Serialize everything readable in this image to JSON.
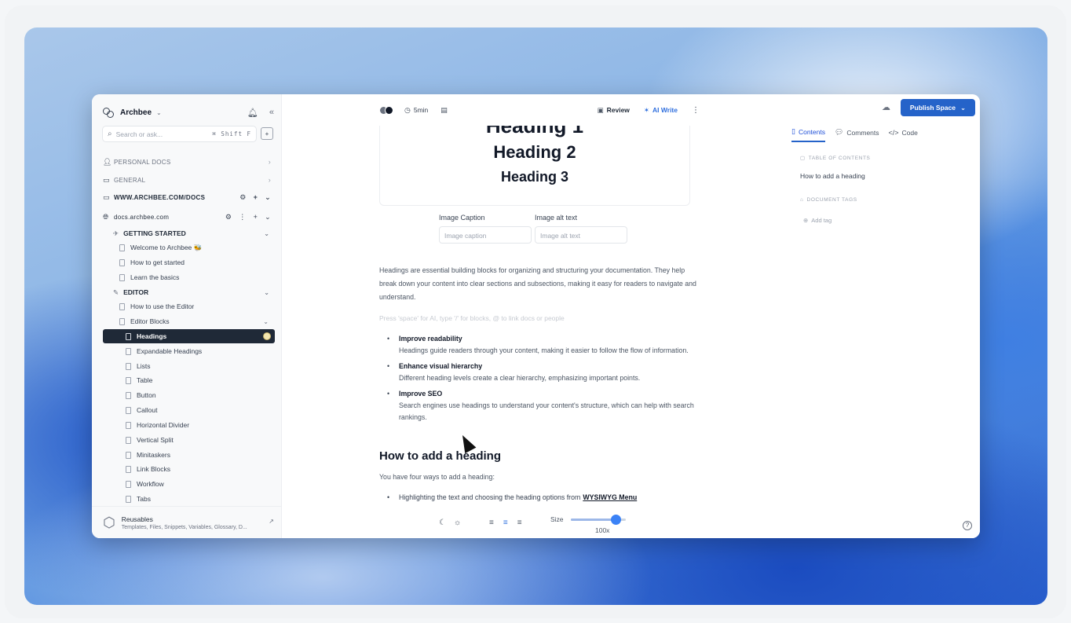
{
  "sidebar": {
    "brand": "Archbee",
    "search_placeholder": "Search or ask...",
    "search_shortcut": "⌘ Shift F",
    "sections": [
      {
        "label": "PERSONAL DOCS"
      },
      {
        "label": "GENERAL"
      },
      {
        "label": "WWW.ARCHBEE.COM/DOCS"
      },
      {
        "label": "docs.archbee.com"
      }
    ],
    "tree": [
      {
        "label": "GETTING STARTED",
        "type": "group"
      },
      {
        "label": "Welcome to Archbee 🐝",
        "type": "doc"
      },
      {
        "label": "How to get started",
        "type": "doc"
      },
      {
        "label": "Learn the basics",
        "type": "doc"
      },
      {
        "label": "EDITOR",
        "type": "group"
      },
      {
        "label": "How to use the Editor",
        "type": "doc"
      },
      {
        "label": "Editor Blocks",
        "type": "doc"
      },
      {
        "label": "Headings",
        "type": "doc",
        "active": true
      },
      {
        "label": "Expandable Headings",
        "type": "doc"
      },
      {
        "label": "Lists",
        "type": "doc"
      },
      {
        "label": "Table",
        "type": "doc"
      },
      {
        "label": "Button",
        "type": "doc"
      },
      {
        "label": "Callout",
        "type": "doc"
      },
      {
        "label": "Horizontal Divider",
        "type": "doc"
      },
      {
        "label": "Vertical Split",
        "type": "doc"
      },
      {
        "label": "Minitaskers",
        "type": "doc"
      },
      {
        "label": "Link Blocks",
        "type": "doc"
      },
      {
        "label": "Workflow",
        "type": "doc"
      },
      {
        "label": "Tabs",
        "type": "doc"
      }
    ],
    "reusables": {
      "title": "Reusables",
      "subtitle": "Templates, Files, Snippets, Variables, Glossary, D..."
    }
  },
  "toolbar": {
    "read_time": "5min",
    "review": "Review",
    "ai_write": "AI Write"
  },
  "editor": {
    "heading1": "Heading 1",
    "heading2": "Heading 2",
    "heading3": "Heading 3",
    "image_caption_label": "Image Caption",
    "image_alt_label": "Image alt text",
    "image_caption_placeholder": "Image caption",
    "image_alt_placeholder": "Image alt text",
    "intro": "Headings are essential building blocks for organizing and structuring your documentation. They help break down your content into clear sections and subsections, making it easy for readers to navigate and understand.",
    "placeholder": "Press 'space' for AI, type '/' for blocks, @ to link docs or people",
    "bullets": [
      {
        "title": "Improve readability",
        "text": "Headings guide readers through your content, making it easier to follow the flow of information."
      },
      {
        "title": "Enhance visual hierarchy",
        "text": "Different heading levels create a clear hierarchy, emphasizing important points."
      },
      {
        "title": "Improve SEO",
        "text": "Search engines use headings to understand your content's structure, which can help with search rankings."
      }
    ],
    "section_heading": "How to add a heading",
    "section_text": "You have four ways to add a heading:",
    "bullet2_text": "Highlighting the text and choosing the heading options from",
    "bullet2_link": "WYSIWYG Menu",
    "size_label": "Size",
    "size_value": "100x",
    "size_level": 0.82
  },
  "right_panel": {
    "publish": "Publish Space",
    "tabs": [
      "Contents",
      "Comments",
      "Code"
    ],
    "toc_label": "TABLE OF CONTENTS",
    "toc_items": [
      "How to add a heading"
    ],
    "tags_label": "DOCUMENT TAGS",
    "add_tag": "Add tag"
  },
  "colors": {
    "accent": "#2563c9",
    "active_nav": "#1f2937"
  }
}
